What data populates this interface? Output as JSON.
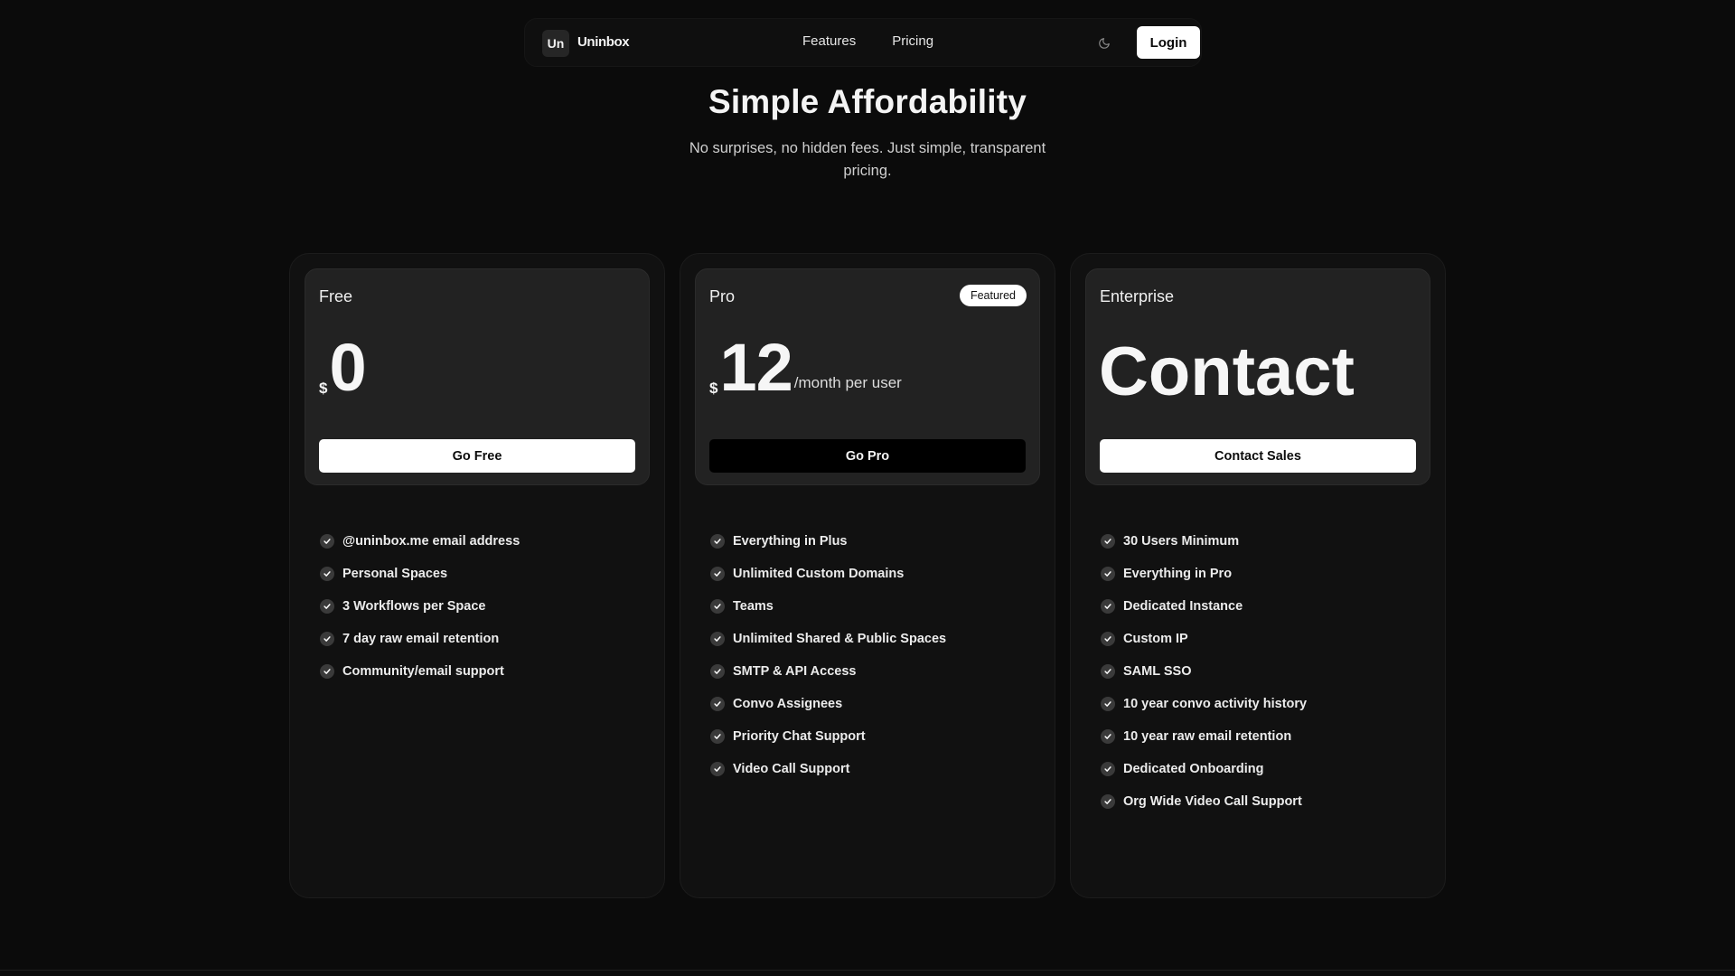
{
  "nav": {
    "brand_mark": "Un",
    "brand_name": "Uninbox",
    "links": [
      "Features",
      "Pricing"
    ],
    "theme_icon": "moon-icon",
    "login_label": "Login"
  },
  "hero": {
    "title": "Simple Affordability",
    "subtitle": "No surprises, no hidden fees. Just simple, transparent pricing."
  },
  "colors": {
    "background": "#0b0b0b",
    "card": "#111111",
    "card_inner": "#222222",
    "accent": "#ffffff"
  },
  "plans": [
    {
      "name": "Free",
      "currency": "$",
      "price": "0",
      "unit": "",
      "cta": "Go Free",
      "features": [
        "@uninbox.me email address",
        "Personal Spaces",
        "3 Workflows per Space",
        "7 day raw email retention",
        "Community/email support"
      ]
    },
    {
      "name": "Pro",
      "badge": "Featured",
      "currency": "$",
      "price": "12",
      "unit": "/month per user",
      "cta": "Go Pro",
      "features": [
        "Everything in Plus",
        "Unlimited Custom Domains",
        "Teams",
        "Unlimited Shared & Public Spaces",
        "SMTP & API Access",
        "Convo Assignees",
        "Priority Chat Support",
        "Video Call Support"
      ]
    },
    {
      "name": "Enterprise",
      "price": "Contact",
      "cta": "Contact Sales",
      "features": [
        "30 Users Minimum",
        "Everything in Pro",
        "Dedicated Instance",
        "Custom IP",
        "SAML SSO",
        "10 year convo activity history",
        "10 year raw email retention",
        "Dedicated Onboarding",
        "Org Wide Video Call Support"
      ]
    }
  ]
}
